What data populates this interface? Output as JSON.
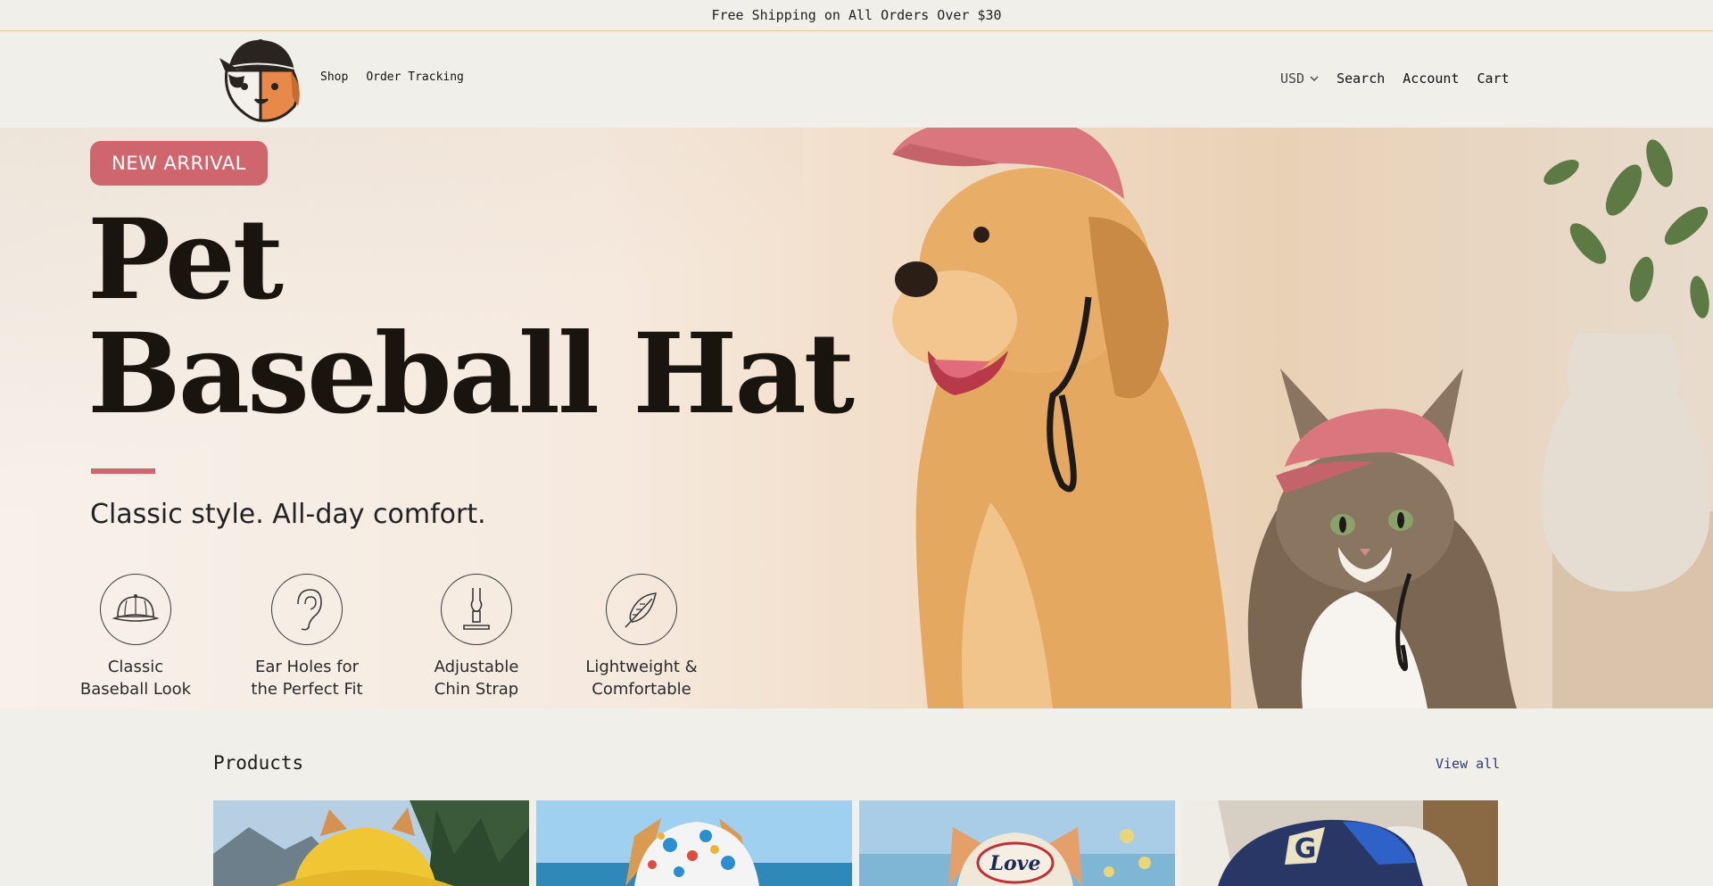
{
  "announcement": {
    "text": "Free Shipping on All Orders Over $30"
  },
  "header": {
    "logo_alt": "pet brand logo",
    "nav_left": [
      {
        "label": "Shop"
      },
      {
        "label": "Order Tracking"
      }
    ],
    "currency": {
      "value": "USD"
    },
    "nav_right": [
      {
        "label": "Search"
      },
      {
        "label": "Account"
      },
      {
        "label": "Cart"
      }
    ]
  },
  "hero": {
    "badge": "NEW ARRIVAL",
    "title_line1": "Pet",
    "title_line2": "Baseball Hat",
    "subtitle": "Classic style. All-day comfort.",
    "features": [
      {
        "line1": "Classic",
        "line2": "Baseball Look",
        "icon": "cap-icon"
      },
      {
        "line1": "Ear Holes for",
        "line2": "the Perfect Fit",
        "icon": "ear-icon"
      },
      {
        "line1": "Adjustable",
        "line2": "Chin Strap",
        "icon": "strap-icon"
      },
      {
        "line1": "Lightweight &",
        "line2": "Comfortable",
        "icon": "feather-icon"
      }
    ],
    "colors": {
      "accent": "#d0666d",
      "hat": "#d9777d"
    }
  },
  "products": {
    "title": "Products",
    "view_all": "View all",
    "cards": [
      {
        "name": "yellow-bucket-hat"
      },
      {
        "name": "polka-dot-bucket-hat"
      },
      {
        "name": "love-baseball-hat"
      },
      {
        "name": "blue-g-trucker-hat"
      }
    ]
  }
}
